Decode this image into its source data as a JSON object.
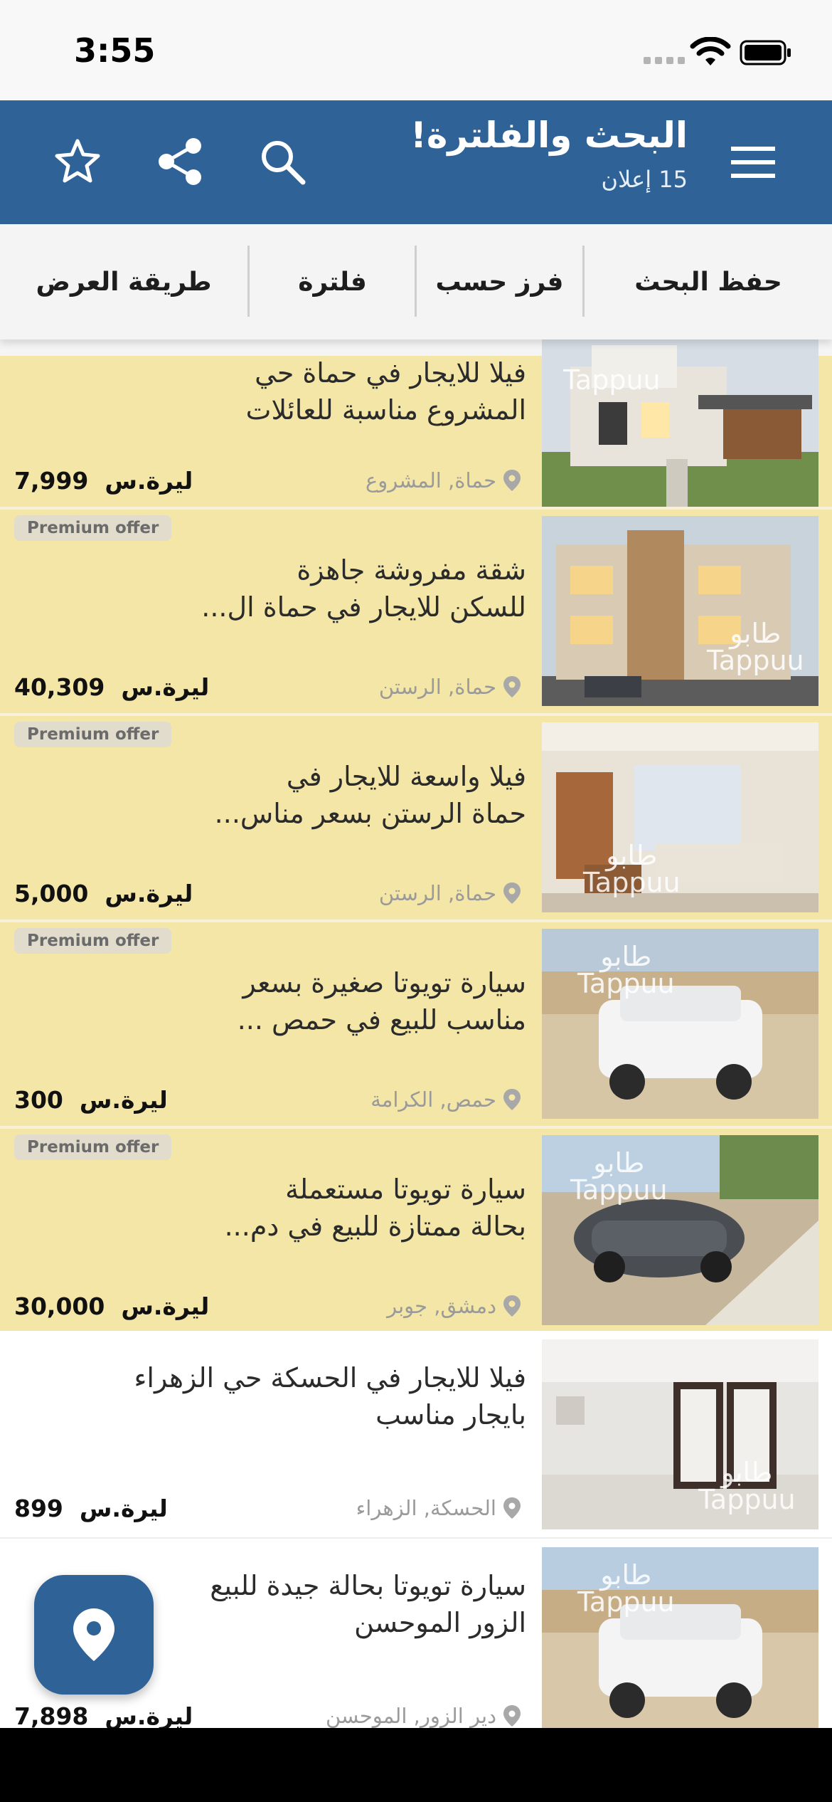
{
  "status_bar": {
    "time": "3:55"
  },
  "header": {
    "title": "البحث والفلترة!",
    "subtitle": "15 إعلان"
  },
  "toolbar": {
    "save_search": "حفظ البحث",
    "sort_by": "فرز حسب",
    "filter": "فلترة",
    "view_mode": "طريقة العرض"
  },
  "listings": [
    {
      "title_line1": "فيلا للايجار في حماة حي",
      "title_line2": "المشروع مناسبة للعائلات",
      "location": "حماة, المشروع",
      "price": "7,999",
      "currency": "ليرة.س",
      "premium": true,
      "badge": "",
      "image": "house-icon"
    },
    {
      "title_line1": "شقة مفروشة جاهزة",
      "title_line2": "للسكن للايجار في حماة ال...",
      "location": "حماة, الرستن",
      "price": "40,309",
      "currency": "ليرة.س",
      "premium": true,
      "badge": "Premium offer",
      "image": "building-icon"
    },
    {
      "title_line1": "فيلا واسعة للايجار في",
      "title_line2": "حماة الرستن بسعر مناس...",
      "location": "حماة, الرستن",
      "price": "5,000",
      "currency": "ليرة.س",
      "premium": true,
      "badge": "Premium offer",
      "image": "living-room-icon"
    },
    {
      "title_line1": "سيارة تويوتا صغيرة بسعر",
      "title_line2": "مناسب للبيع في حمص ...",
      "location": "حمص, الكرامة",
      "price": "300",
      "currency": "ليرة.س",
      "premium": true,
      "badge": "Premium offer",
      "image": "suv-icon"
    },
    {
      "title_line1": "سيارة تويوتا مستعملة",
      "title_line2": "بحالة ممتازة للبيع في دم...",
      "location": "دمشق, جوبر",
      "price": "30,000",
      "currency": "ليرة.س",
      "premium": true,
      "badge": "Premium offer",
      "image": "sedan-icon"
    },
    {
      "title_line1": "فيلا للايجار في الحسكة حي الزهراء",
      "title_line2": "بايجار مناسب",
      "location": "الحسكة, الزهراء",
      "price": "899",
      "currency": "ليرة.س",
      "premium": false,
      "badge": "",
      "image": "interior-icon"
    },
    {
      "title_line1": "سيارة تويوتا بحالة جيدة للبيع",
      "title_line2": "الزور الموحسن",
      "location": "دير الزور, الموحسن",
      "price": "7,898",
      "currency": "ليرة.س",
      "premium": false,
      "badge": "",
      "image": "suv-icon"
    }
  ],
  "watermark": {
    "arabic": "طابو",
    "latin": "Tappuu"
  }
}
